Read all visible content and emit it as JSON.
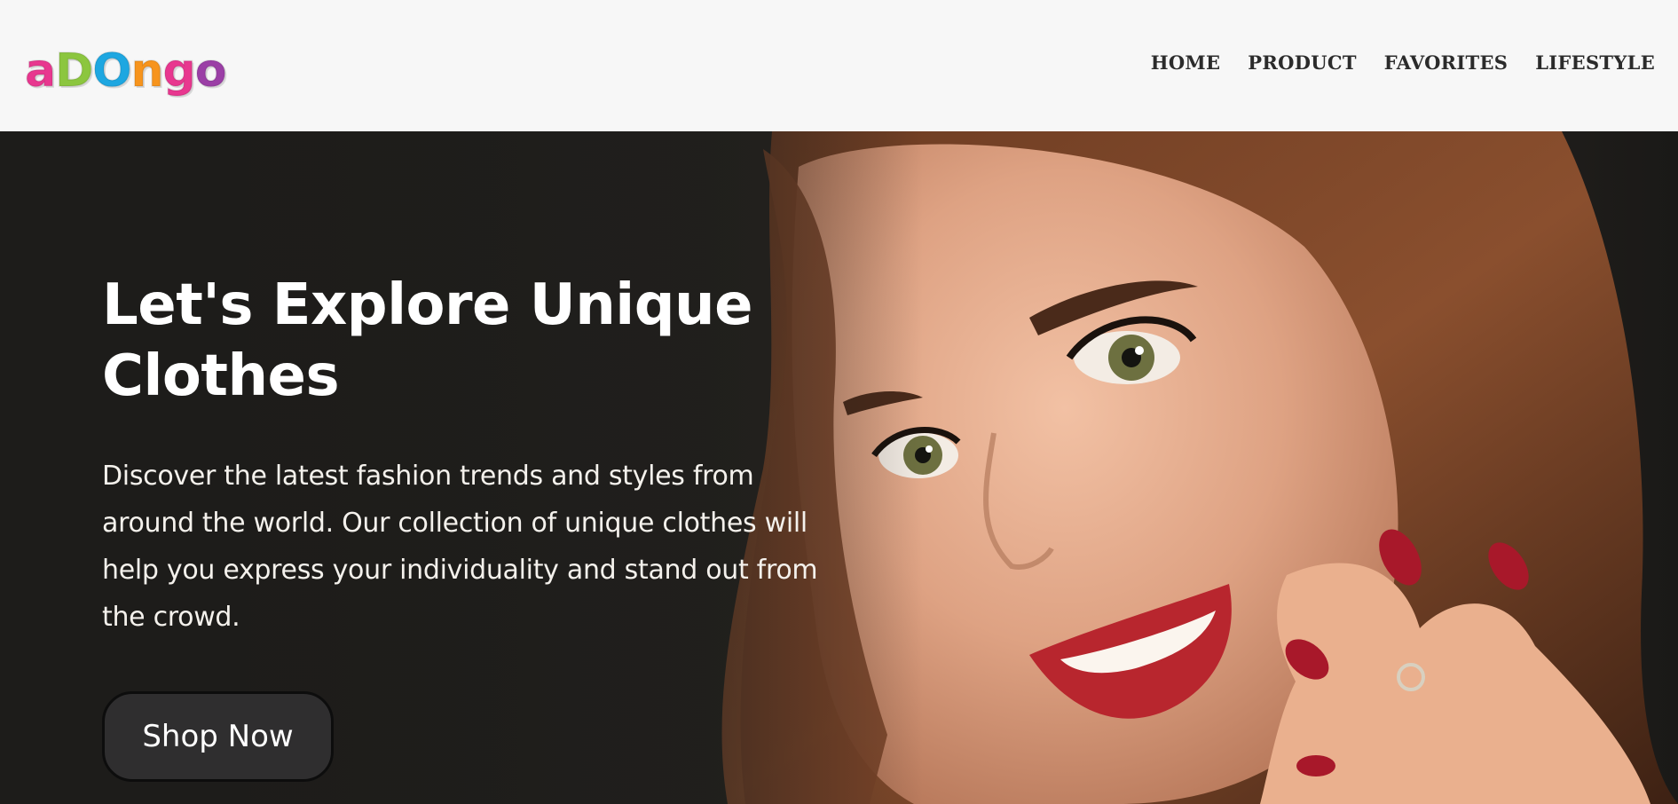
{
  "brand": {
    "logo_letters": [
      {
        "char": "a",
        "color": "#e8378f"
      },
      {
        "char": "D",
        "color": "#8cc63f"
      },
      {
        "char": "O",
        "color": "#1ea7e1"
      },
      {
        "char": "n",
        "color": "#f7941d"
      },
      {
        "char": "g",
        "color": "#e8378f"
      },
      {
        "char": "o",
        "color": "#9b3fa6"
      }
    ]
  },
  "nav": {
    "items": [
      {
        "label": "HOME"
      },
      {
        "label": "PRODUCT"
      },
      {
        "label": "FAVORITES"
      },
      {
        "label": "LIFESTYLE"
      }
    ]
  },
  "hero": {
    "title": "Let's Explore Unique Clothes",
    "description": "Discover the latest fashion trends and styles from around the world. Our collection of unique clothes will help you express your individuality and stand out from the crowd.",
    "cta_label": "Shop Now",
    "image_subject": "smiling woman with long brown hair and red nail polish touching her chin"
  },
  "colors": {
    "header_bg": "#f7f7f7",
    "nav_text": "#2b2b2b",
    "hero_bg": "#1f1d1b",
    "button_bg": "#2f2e2f",
    "hero_text": "#ffffff"
  }
}
